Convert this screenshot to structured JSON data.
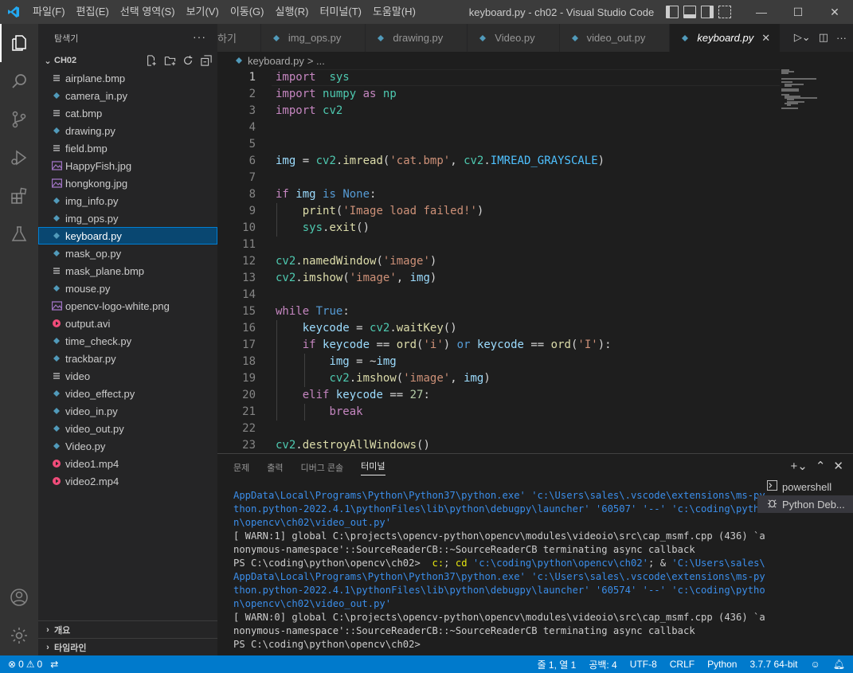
{
  "window": {
    "title": "keyboard.py - ch02 - Visual Studio Code",
    "menu": [
      "파일(F)",
      "편집(E)",
      "선택 영역(S)",
      "보기(V)",
      "이동(G)",
      "실행(R)",
      "터미널(T)",
      "도움말(H)"
    ]
  },
  "sidebar": {
    "title": "탐색기",
    "folder": "CH02",
    "files": [
      {
        "name": "airplane.bmp",
        "icon": "bmp-icon"
      },
      {
        "name": "camera_in.py",
        "icon": "python-icon"
      },
      {
        "name": "cat.bmp",
        "icon": "bmp-icon"
      },
      {
        "name": "drawing.py",
        "icon": "python-icon"
      },
      {
        "name": "field.bmp",
        "icon": "bmp-icon"
      },
      {
        "name": "HappyFish.jpg",
        "icon": "image-icon"
      },
      {
        "name": "hongkong.jpg",
        "icon": "image-icon"
      },
      {
        "name": "img_info.py",
        "icon": "python-icon"
      },
      {
        "name": "img_ops.py",
        "icon": "python-icon"
      },
      {
        "name": "keyboard.py",
        "icon": "python-icon",
        "selected": true
      },
      {
        "name": "mask_op.py",
        "icon": "python-icon"
      },
      {
        "name": "mask_plane.bmp",
        "icon": "bmp-icon"
      },
      {
        "name": "mouse.py",
        "icon": "python-icon"
      },
      {
        "name": "opencv-logo-white.png",
        "icon": "image-icon"
      },
      {
        "name": "output.avi",
        "icon": "video-icon"
      },
      {
        "name": "time_check.py",
        "icon": "python-icon"
      },
      {
        "name": "trackbar.py",
        "icon": "python-icon"
      },
      {
        "name": "video",
        "icon": "file-icon"
      },
      {
        "name": "video_effect.py",
        "icon": "python-icon"
      },
      {
        "name": "video_in.py",
        "icon": "python-icon"
      },
      {
        "name": "video_out.py",
        "icon": "python-icon"
      },
      {
        "name": "Video.py",
        "icon": "python-icon"
      },
      {
        "name": "video1.mp4",
        "icon": "video-icon"
      },
      {
        "name": "video2.mp4",
        "icon": "video-icon"
      }
    ],
    "outline_label": "개요",
    "timeline_label": "타임라인"
  },
  "tabs": [
    {
      "label": "하기",
      "active": false
    },
    {
      "label": "img_ops.py",
      "active": false
    },
    {
      "label": "drawing.py",
      "active": false
    },
    {
      "label": "Video.py",
      "active": false
    },
    {
      "label": "video_out.py",
      "active": false
    },
    {
      "label": "keyboard.py",
      "active": true
    }
  ],
  "breadcrumb": {
    "file": "keyboard.py",
    "rest": "> ..."
  },
  "editor": {
    "current_line": 1,
    "lines": [
      [
        [
          "kw",
          "import"
        ],
        [
          "",
          "  "
        ],
        [
          "mod",
          "sys"
        ]
      ],
      [
        [
          "kw",
          "import"
        ],
        [
          "",
          ""
        ],
        [
          "mod",
          "numpy"
        ],
        [
          "",
          ""
        ],
        [
          "kw",
          "as"
        ],
        [
          "",
          ""
        ],
        [
          "mod",
          "np"
        ]
      ],
      [
        [
          "kw",
          "import"
        ],
        [
          "",
          ""
        ],
        [
          "mod",
          "cv2"
        ]
      ],
      [],
      [],
      [
        [
          "var",
          "img"
        ],
        [
          "",
          " = "
        ],
        [
          "mod",
          "cv2"
        ],
        [
          "",
          "."
        ],
        [
          "fn",
          "imread"
        ],
        [
          "",
          "("
        ],
        [
          "str",
          "'cat.bmp'"
        ],
        [
          "",
          ", "
        ],
        [
          "mod",
          "cv2"
        ],
        [
          "",
          "."
        ],
        [
          "const",
          "IMREAD_GRAYSCALE"
        ],
        [
          "",
          ")"
        ]
      ],
      [],
      [
        [
          "kw",
          "if"
        ],
        [
          "",
          ""
        ],
        [
          "var",
          "img"
        ],
        [
          "",
          ""
        ],
        [
          "kw2",
          "is"
        ],
        [
          "",
          ""
        ],
        [
          "kw2",
          "None"
        ],
        [
          "",
          ":"
        ]
      ],
      [
        [
          "",
          "    "
        ],
        [
          "fn",
          "print"
        ],
        [
          "",
          "("
        ],
        [
          "str",
          "'Image load failed!'"
        ],
        [
          "",
          ")"
        ]
      ],
      [
        [
          "",
          "    "
        ],
        [
          "mod",
          "sys"
        ],
        [
          "",
          "."
        ],
        [
          "fn",
          "exit"
        ],
        [
          "",
          "()"
        ]
      ],
      [],
      [
        [
          "mod",
          "cv2"
        ],
        [
          "",
          "."
        ],
        [
          "fn",
          "namedWindow"
        ],
        [
          "",
          "("
        ],
        [
          "str",
          "'image'"
        ],
        [
          "",
          ")"
        ]
      ],
      [
        [
          "mod",
          "cv2"
        ],
        [
          "",
          "."
        ],
        [
          "fn",
          "imshow"
        ],
        [
          "",
          "("
        ],
        [
          "str",
          "'image'"
        ],
        [
          "",
          ", "
        ],
        [
          "var",
          "img"
        ],
        [
          "",
          ")"
        ]
      ],
      [],
      [
        [
          "kw",
          "while"
        ],
        [
          "",
          ""
        ],
        [
          "kw2",
          "True"
        ],
        [
          "",
          ":"
        ]
      ],
      [
        [
          "",
          "    "
        ],
        [
          "var",
          "keycode"
        ],
        [
          "",
          " = "
        ],
        [
          "mod",
          "cv2"
        ],
        [
          "",
          "."
        ],
        [
          "fn",
          "waitKey"
        ],
        [
          "",
          "()"
        ]
      ],
      [
        [
          "",
          "    "
        ],
        [
          "kw",
          "if"
        ],
        [
          "",
          ""
        ],
        [
          "var",
          "keycode"
        ],
        [
          "",
          " == "
        ],
        [
          "fn",
          "ord"
        ],
        [
          "",
          "("
        ],
        [
          "str",
          "'i'"
        ],
        [
          "",
          ") "
        ],
        [
          "kw2",
          "or"
        ],
        [
          "",
          ""
        ],
        [
          "var",
          "keycode"
        ],
        [
          "",
          " == "
        ],
        [
          "fn",
          "ord"
        ],
        [
          "",
          "("
        ],
        [
          "str",
          "'I'"
        ],
        [
          "",
          "):"
        ]
      ],
      [
        [
          "",
          "        "
        ],
        [
          "var",
          "img"
        ],
        [
          "",
          " = ~"
        ],
        [
          "var",
          "img"
        ]
      ],
      [
        [
          "",
          "        "
        ],
        [
          "mod",
          "cv2"
        ],
        [
          "",
          "."
        ],
        [
          "fn",
          "imshow"
        ],
        [
          "",
          "("
        ],
        [
          "str",
          "'image'"
        ],
        [
          "",
          ", "
        ],
        [
          "var",
          "img"
        ],
        [
          "",
          ")"
        ]
      ],
      [
        [
          "",
          "    "
        ],
        [
          "kw",
          "elif"
        ],
        [
          "",
          ""
        ],
        [
          "var",
          "keycode"
        ],
        [
          "",
          " == "
        ],
        [
          "num",
          "27"
        ],
        [
          "",
          ":"
        ]
      ],
      [
        [
          "",
          "        "
        ],
        [
          "kw",
          "break"
        ]
      ],
      [],
      [
        [
          "mod",
          "cv2"
        ],
        [
          "",
          "."
        ],
        [
          "fn",
          "destroyAllWindows"
        ],
        [
          "",
          "()"
        ]
      ]
    ]
  },
  "panel": {
    "tabs": [
      {
        "label": "문제",
        "active": false
      },
      {
        "label": "출력",
        "active": false
      },
      {
        "label": "디버그 콘솔",
        "active": false
      },
      {
        "label": "터미널",
        "active": true
      }
    ],
    "terminal_lines": [
      [
        [
          "t-blue",
          "AppData\\Local\\Programs\\Python\\Python37\\python.exe' 'c:\\Users\\sales\\.vscode\\extensions\\ms-py"
        ]
      ],
      [
        [
          "t-blue",
          "thon.python-2022.4.1\\pythonFiles\\lib\\python\\debugpy\\launcher' '60507' '--' 'c:\\coding\\pytho"
        ]
      ],
      [
        [
          "t-blue",
          "n\\opencv\\ch02\\video_out.py'"
        ]
      ],
      [
        [
          "",
          "[ WARN:1] global C:\\projects\\opencv-python\\opencv\\modules\\videoio\\src\\cap_msmf.cpp (436) `a"
        ]
      ],
      [
        [
          "",
          "nonymous-namespace'::SourceReaderCB::~SourceReaderCB terminating async callback"
        ]
      ],
      [
        [
          "",
          "PS C:\\coding\\python\\opencv\\ch02>  "
        ],
        [
          "t-yellow",
          "c:"
        ],
        [
          "",
          "; "
        ],
        [
          "t-yellow",
          "cd"
        ],
        [
          "",
          ""
        ],
        [
          "t-blue",
          "'c:\\coding\\python\\opencv\\ch02'"
        ],
        [
          "",
          "; & "
        ],
        [
          "t-blue",
          "'C:\\Users\\sales\\"
        ]
      ],
      [
        [
          "t-blue",
          "AppData\\Local\\Programs\\Python\\Python37\\python.exe' 'c:\\Users\\sales\\.vscode\\extensions\\ms-py"
        ]
      ],
      [
        [
          "t-blue",
          "thon.python-2022.4.1\\pythonFiles\\lib\\python\\debugpy\\launcher' '60574' '--' 'c:\\coding\\pytho"
        ]
      ],
      [
        [
          "t-blue",
          "n\\opencv\\ch02\\video_out.py'"
        ]
      ],
      [
        [
          "",
          "[ WARN:0] global C:\\projects\\opencv-python\\opencv\\modules\\videoio\\src\\cap_msmf.cpp (436) `a"
        ]
      ],
      [
        [
          "",
          "nonymous-namespace'::SourceReaderCB::~SourceReaderCB terminating async callback"
        ]
      ],
      [
        [
          "",
          "PS C:\\coding\\python\\opencv\\ch02>"
        ]
      ]
    ],
    "terminals": [
      {
        "label": "powershell",
        "icon": "terminal-icon",
        "active": false
      },
      {
        "label": "Python Deb...",
        "icon": "debug-icon",
        "active": true
      }
    ]
  },
  "statusbar": {
    "errors": "0",
    "warnings": "0",
    "position": "줄 1, 열 1",
    "spaces": "공백: 4",
    "encoding": "UTF-8",
    "eol": "CRLF",
    "language": "Python",
    "interpreter": "3.7.7 64-bit"
  },
  "colors": {
    "accent": "#007acc",
    "python_icon": "#519aba",
    "video_icon": "#f14c7a",
    "image_icon": "#a074c4"
  }
}
